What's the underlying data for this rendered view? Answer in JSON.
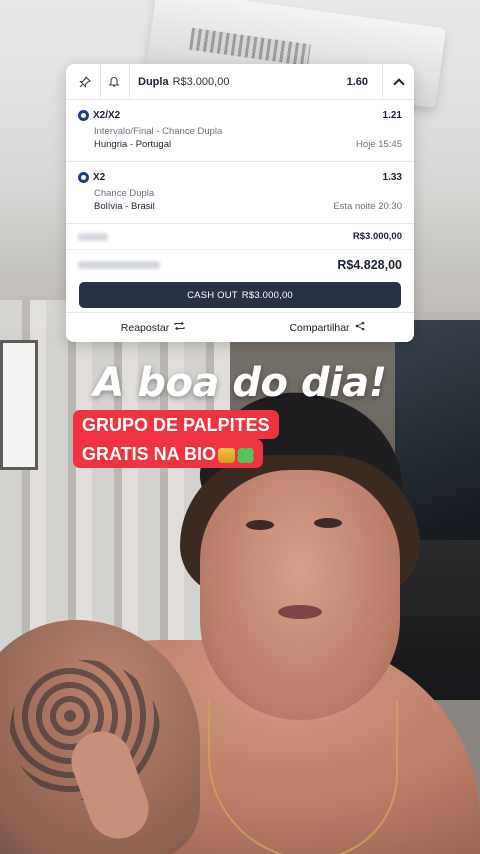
{
  "ticket": {
    "bet_type": "Dupla",
    "header_amount": "R$3.000,00",
    "total_odds": "1.60",
    "selections": [
      {
        "pick": "X2/X2",
        "odds": "1.21",
        "market": "Intervalo/Final - Chance Dupla",
        "event": "Hungria - Portugal",
        "time": "Hoje 15:45"
      },
      {
        "pick": "X2",
        "odds": "1.33",
        "market": "Chance Dupla",
        "event": "Bolívia - Brasil",
        "time": "Esta noite 20:30"
      }
    ],
    "stake_value": "R$3.000,00",
    "return_value": "R$4.828,00",
    "cashout": {
      "label": "CASH OUT",
      "amount": "R$3.000,00"
    },
    "footer": {
      "rebet_label": "Reapostar",
      "share_label": "Compartilhar"
    }
  },
  "icons": {
    "pin": "pin-icon",
    "bell": "bell-icon",
    "collapse": "chevron-up-icon",
    "rebet": "repeat-icon",
    "share": "share-icon",
    "sport": "soccer-ball-icon"
  },
  "caption": {
    "headline": "A boa do dia!",
    "promo_line1": "GRUPO DE PALPITES",
    "promo_line2": "GRATIS NA BIO"
  },
  "colors": {
    "promo_red": "#ef3340",
    "cashout_bg": "#283244",
    "sport_icon": "#1e3f7a"
  }
}
